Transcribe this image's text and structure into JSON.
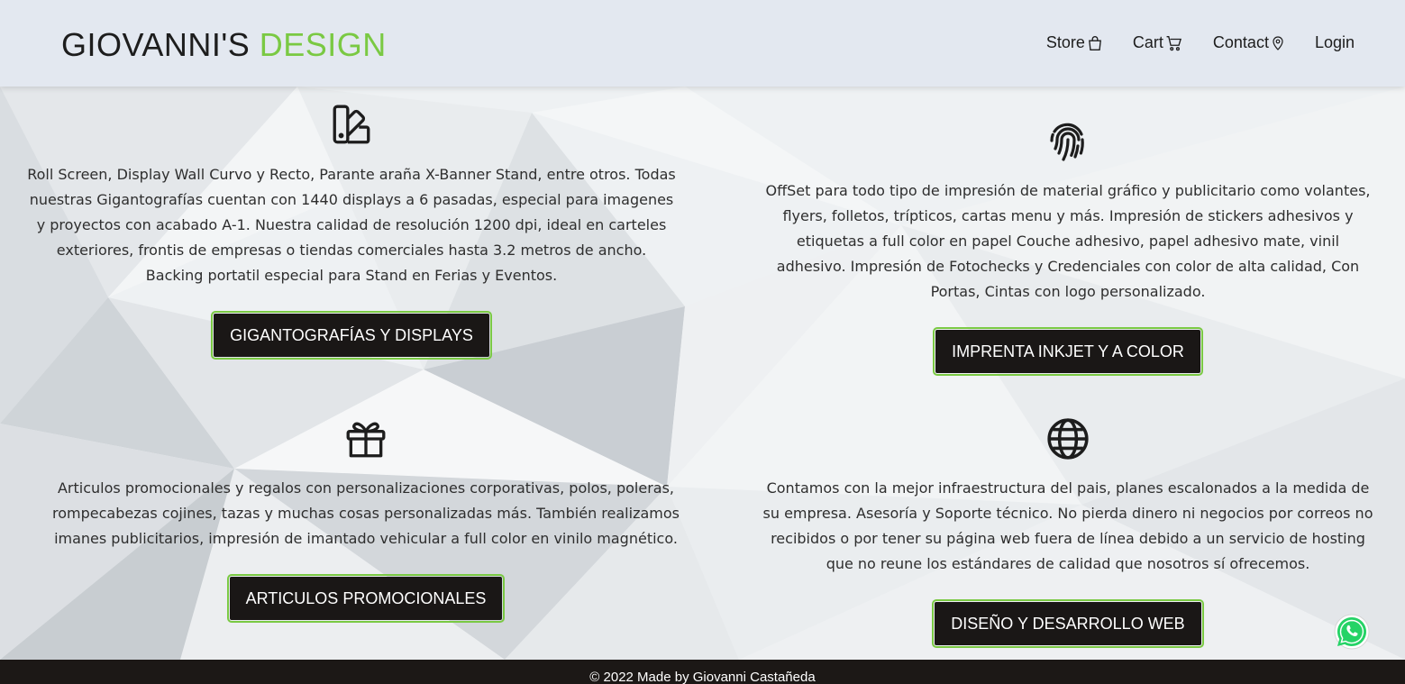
{
  "header": {
    "brand_main": "GIOVANNI'S",
    "brand_accent": "DESIGN",
    "nav": [
      {
        "label": "Store",
        "icon": "shopping-bag-icon"
      },
      {
        "label": "Cart",
        "icon": "shopping-cart-icon"
      },
      {
        "label": "Contact",
        "icon": "map-pin-icon"
      },
      {
        "label": "Login",
        "icon": ""
      }
    ]
  },
  "services": [
    {
      "icon": "swatchbook-icon",
      "text": "Roll Screen, Display Wall Curvo y Recto, Parante araña X-Banner Stand, entre otros. Todas nuestras Gigantografías cuentan con 1440 displays a 6 pasadas, especial para imagenes y proyectos con acabado A-1. Nuestra calidad de resolución 1200 dpi, ideal en carteles exteriores, frontis de empresas o tiendas comerciales hasta 3.2 metros de ancho. Backing portatil especial para Stand en Ferias y Eventos.",
      "button": "GIGANTOGRAFÍAS Y DISPLAYS"
    },
    {
      "icon": "fingerprint-icon",
      "text": "OffSet para todo tipo de impresión de material gráfico y publicitario como volantes, flyers, folletos, trípticos, cartas menu y más. Impresión de stickers adhesivos y etiquetas a full color en papel Couche adhesivo, papel adhesivo mate, vinil adhesivo. Impresión de Fotochecks y Credenciales con color de alta calidad, Con Portas, Cintas con logo personalizado.",
      "button": "IMPRENTA INKJET Y A COLOR"
    },
    {
      "icon": "gift-icon",
      "text": "Articulos promocionales y regalos con personalizaciones corporativas, polos, poleras, rompecabezas cojines, tazas y muchas cosas personalizadas más. También realizamos imanes publicitarios, impresión de imantado vehicular a full color en vinilo magnético.",
      "button": "ARTICULOS PROMOCIONALES"
    },
    {
      "icon": "globe-icon",
      "text": "Contamos con la mejor infraestructura del pais, planes escalonados a la medida de su empresa. Asesoría y Soporte técnico. No pierda dinero ni negocios por correos no recibidos o por tener su página web fuera de línea debido a un servicio de hosting que no reune los estándares de calidad que nosotros sí ofrecemos.",
      "button": "DISEÑO Y DESARROLLO WEB"
    }
  ],
  "footer": {
    "text": "© 2022 Made by Giovanni Castañeda"
  },
  "colors": {
    "accent": "#7ac943",
    "button_bg": "#1a1716",
    "header_bg": "#e3e8f0",
    "footer_bg": "#1c1816",
    "whatsapp": "#25d366"
  }
}
